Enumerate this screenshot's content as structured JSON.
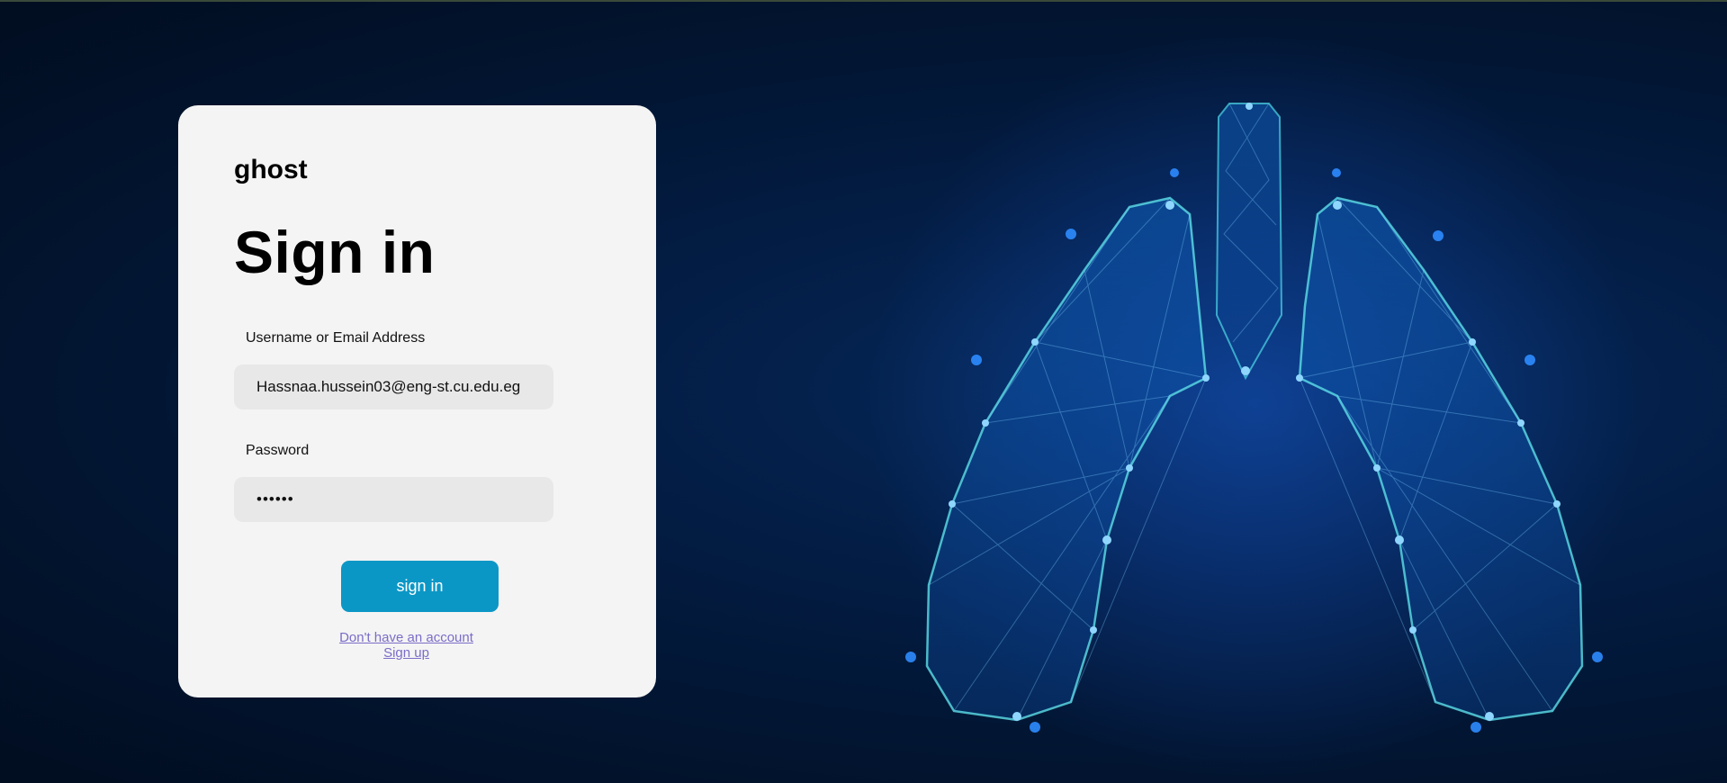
{
  "brand": "ghost",
  "heading": "Sign in",
  "form": {
    "username_label": "Username or Email Address",
    "username_value": "Hassnaa.hussein03@eng-st.cu.edu.eg",
    "password_label": "Password",
    "password_value": "••••••",
    "submit_label": "sign in"
  },
  "links": {
    "no_account": "Don't have an account",
    "sign_up": "Sign up"
  },
  "background": {
    "illustration": "lungs-network-illustration",
    "colors": {
      "base": "#02142f",
      "glow": "#1e8bff",
      "line": "#4fd8e8"
    }
  }
}
